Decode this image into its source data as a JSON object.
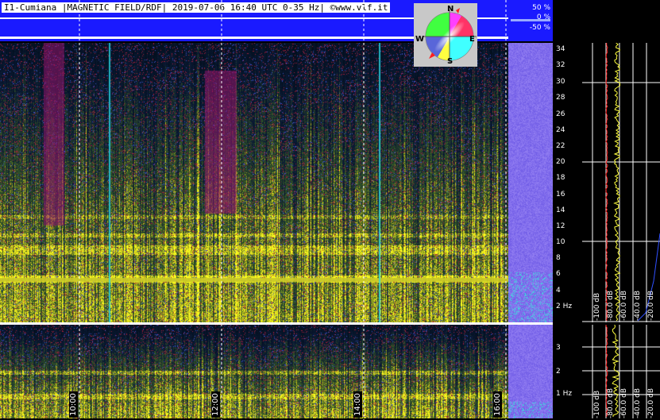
{
  "header": {
    "title": "I1-Cumiana |MAGNETIC FIELD/RDF| 2019-07-06 16:40 UTC 0-35 Hz| ©www.vlf.it",
    "pct_top": "50 %",
    "pct_mid": "0 %",
    "pct_bot": "-50 %"
  },
  "compass": {
    "n": "N",
    "s": "S",
    "e": "E",
    "w": "W"
  },
  "freq_axis_upper": [
    "34",
    "32",
    "30",
    "28",
    "26",
    "24",
    "22",
    "20",
    "18",
    "16",
    "14",
    "12",
    "10",
    "8",
    "6",
    "4",
    "2 Hz"
  ],
  "freq_axis_lower": [
    "3",
    "2",
    "1 Hz"
  ],
  "db_labels": [
    "-100 dB",
    "-80.0 dB",
    "-60.0 dB",
    "-40.0 dB",
    "-20.0 dB"
  ],
  "time_labels": [
    "10:00",
    "12:00",
    "14:00",
    "16:00"
  ],
  "colors": {
    "header_blue": "#1a1aff",
    "profile_red": "#ff2020",
    "profile_yellow": "#ffff40"
  }
}
